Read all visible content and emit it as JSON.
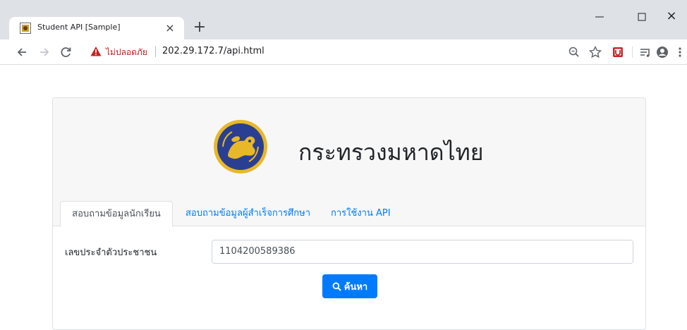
{
  "browser": {
    "tab_title": "Student API [Sample]",
    "new_tab_glyph": "+",
    "close_glyph": "×",
    "security_label": "ไม่ปลอดภัย",
    "url": "202.29.172.7/api.html",
    "icons": [
      "back-icon",
      "forward-icon",
      "reload-icon",
      "warning-icon",
      "zoom-icon",
      "star-icon",
      "extension-icon",
      "media-icon",
      "profile-icon",
      "menu-icon"
    ]
  },
  "page": {
    "ministry_name": "กระทรวงมหาดไทย",
    "tabs": [
      {
        "label": "สอบถามข้อมูลนักเรียน",
        "active": true
      },
      {
        "label": "สอบถามข้อมูลผู้สำเร็จการศึกษา",
        "active": false
      },
      {
        "label": "การใช้งาน API",
        "active": false
      }
    ],
    "form": {
      "id_label": "เลขประจำตัวประชาชน",
      "id_value": "1104200589386",
      "search_label": "ค้นหา"
    }
  },
  "colors": {
    "accent": "#007bff",
    "warning": "#c5221f",
    "seal_blue": "#2a3f91",
    "seal_gold": "#e8b828"
  }
}
